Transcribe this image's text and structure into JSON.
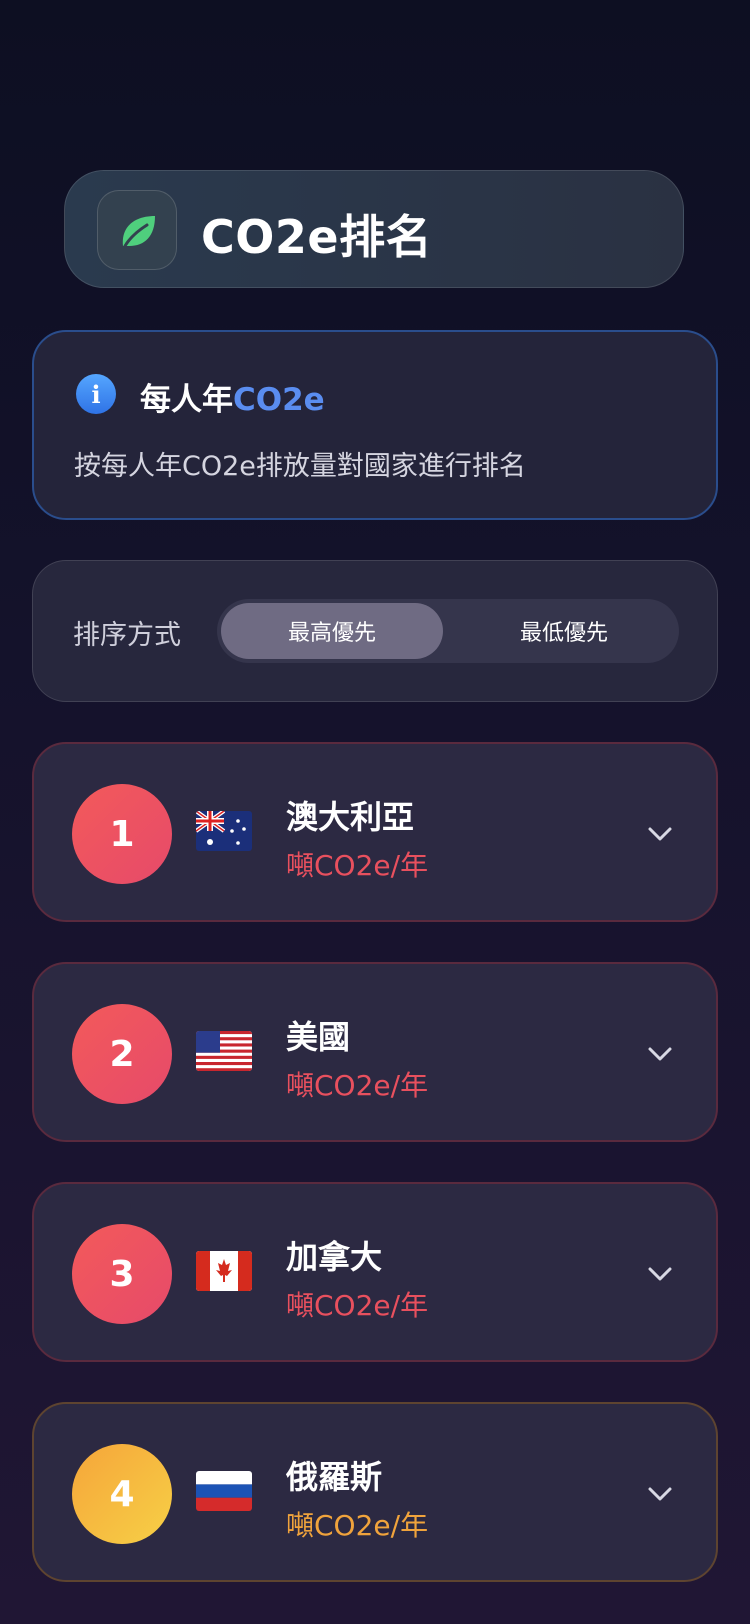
{
  "header": {
    "title": "CO2e排名",
    "icon": "leaf-icon"
  },
  "info": {
    "title_prefix": "每人年",
    "title_highlight": "CO2e",
    "description": "按每人年CO2e排放量對國家進行排名",
    "icon": "info-icon"
  },
  "sort": {
    "label": "排序方式",
    "options": [
      {
        "label": "最高優先",
        "selected": true
      },
      {
        "label": "最低優先",
        "selected": false
      }
    ]
  },
  "rankings": [
    {
      "rank": "1",
      "country": "澳大利亞",
      "unit": "噸CO2e/年",
      "flag": "australia-flag-icon",
      "color": "#e8505e"
    },
    {
      "rank": "2",
      "country": "美國",
      "unit": "噸CO2e/年",
      "flag": "usa-flag-icon",
      "color": "#e8505e"
    },
    {
      "rank": "3",
      "country": "加拿大",
      "unit": "噸CO2e/年",
      "flag": "canada-flag-icon",
      "color": "#e8505e"
    },
    {
      "rank": "4",
      "country": "俄羅斯",
      "unit": "噸CO2e/年",
      "flag": "russia-flag-icon",
      "color": "#f0a33c"
    }
  ]
}
